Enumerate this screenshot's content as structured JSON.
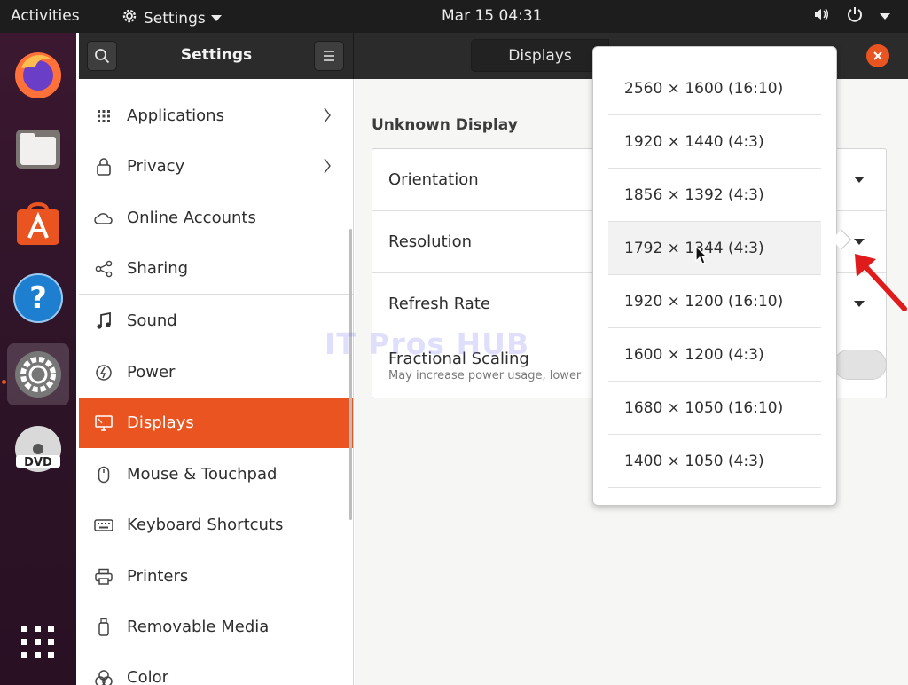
{
  "topbar": {
    "activities": "Activities",
    "app_name": "Settings",
    "clock": "Mar 15  04:31"
  },
  "dock": {
    "apps": [
      "firefox-icon",
      "files-icon",
      "software-icon",
      "help-icon",
      "settings-icon",
      "dvd-icon",
      "show-apps-icon"
    ]
  },
  "settings_header": {
    "title": "Settings"
  },
  "main_header": {
    "tab_displays": "Displays"
  },
  "sidebar": {
    "items": [
      {
        "label": "Applications",
        "icon": "grid-icon",
        "has_chevron": true
      },
      {
        "label": "Privacy",
        "icon": "lock-icon",
        "has_chevron": true
      },
      {
        "label": "Online Accounts",
        "icon": "cloud-icon"
      },
      {
        "label": "Sharing",
        "icon": "share-icon"
      },
      {
        "label": "Sound",
        "icon": "music-note-icon"
      },
      {
        "label": "Power",
        "icon": "power-icon"
      },
      {
        "label": "Displays",
        "icon": "display-icon",
        "selected": true
      },
      {
        "label": "Mouse & Touchpad",
        "icon": "mouse-icon"
      },
      {
        "label": "Keyboard Shortcuts",
        "icon": "keyboard-icon"
      },
      {
        "label": "Printers",
        "icon": "printer-icon"
      },
      {
        "label": "Removable Media",
        "icon": "usb-icon"
      },
      {
        "label": "Color",
        "icon": "color-icon"
      }
    ]
  },
  "display": {
    "title": "Unknown Display",
    "rows": {
      "orientation": "Orientation",
      "resolution": "Resolution",
      "refresh_rate": "Refresh Rate",
      "fractional_scaling": "Fractional Scaling",
      "fractional_scaling_sub": "May increase power usage, lower"
    },
    "fractional_scaling_enabled": false
  },
  "resolution_menu": {
    "options": [
      "2560 × 1600 (16:10)",
      "1920 × 1440 (4:3)",
      "1856 × 1392 (4:3)",
      "1792 × 1344 (4:3)",
      "1920 × 1200 (16:10)",
      "1600 × 1200 (4:3)",
      "1680 × 1050 (16:10)",
      "1400 × 1050 (4:3)"
    ],
    "hovered_index": 3
  },
  "watermark": "IT Pros HUB",
  "colors": {
    "accent": "#e95420",
    "annotation_arrow": "#e01b1b"
  }
}
